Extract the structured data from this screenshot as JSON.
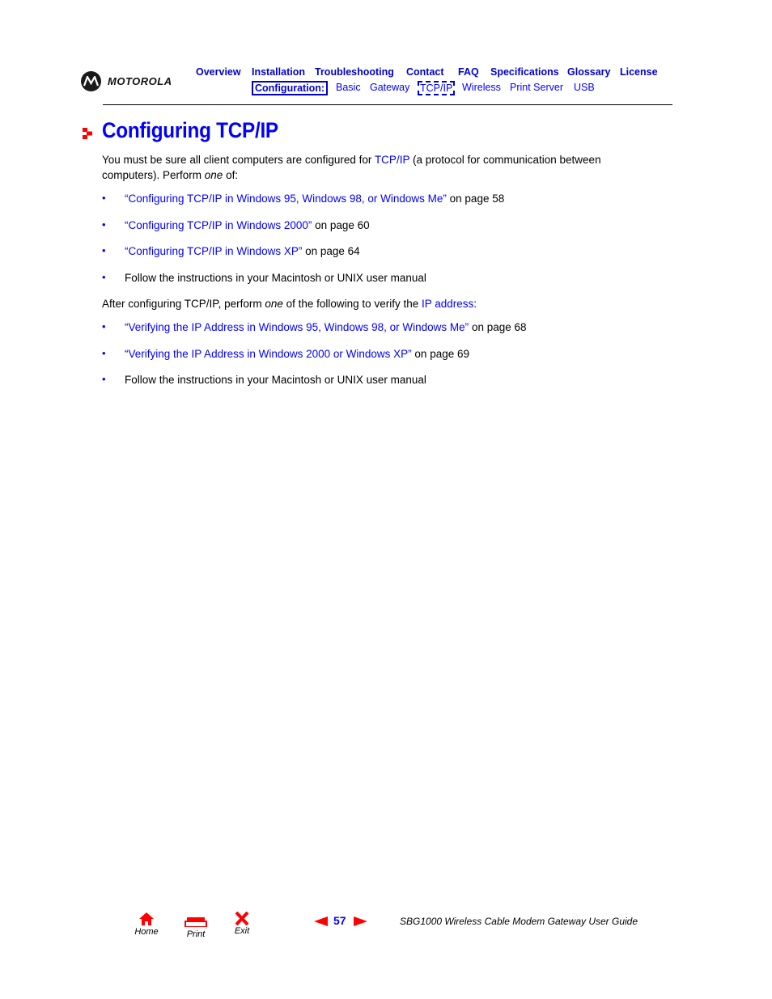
{
  "header": {
    "brand": "MOTOROLA",
    "nav_top": [
      "Overview",
      "Installation",
      "Troubleshooting",
      "Contact",
      "FAQ",
      "Specifications",
      "Glossary",
      "License"
    ],
    "nav_sub_label": "Configuration:",
    "nav_sub": [
      "Basic",
      "Gateway",
      "TCP/IP",
      "Wireless",
      "Print Server",
      "USB"
    ],
    "nav_sub_active": "TCP/IP"
  },
  "page": {
    "title": "Configuring TCP/IP",
    "intro": {
      "before_link": "You must be sure all client computers are configured for ",
      "link": "TCP/IP",
      "after_link": " (a protocol for communication between",
      "line2_before": "computers). Perform ",
      "line2_em": "one",
      "line2_after": " of:"
    },
    "config_items": [
      {
        "link": "“Configuring TCP/IP in Windows 95, Windows 98, or Windows Me”",
        "suffix": " on page 58"
      },
      {
        "link": "“Configuring TCP/IP in Windows 2000”",
        "suffix": " on page 60"
      },
      {
        "link": "“Configuring TCP/IP in Windows XP”",
        "suffix": " on page 64"
      },
      {
        "link": "",
        "suffix": "Follow the instructions in your Macintosh or UNIX user manual"
      }
    ],
    "verify_intro": {
      "before_em": "After configuring TCP/IP, perform ",
      "em": "one",
      "after_em": " of the following to verify the ",
      "link": "IP address",
      "end": ":"
    },
    "verify_items": [
      {
        "link": "“Verifying the IP Address in Windows 95, Windows 98, or Windows Me”",
        "suffix": " on page 68"
      },
      {
        "link": "“Verifying the IP Address in Windows 2000 or Windows XP”",
        "suffix": " on page 69"
      },
      {
        "link": "",
        "suffix": "Follow the instructions in your Macintosh or UNIX user manual"
      }
    ],
    "bullet": "•"
  },
  "footer": {
    "home_label": "Home",
    "print_label": "Print",
    "exit_label": "Exit",
    "page_number": "57",
    "guide_title": "SBG1000 Wireless Cable Modem Gateway User Guide",
    "accent_color": "#ff0000",
    "link_color": "#0000ff"
  }
}
